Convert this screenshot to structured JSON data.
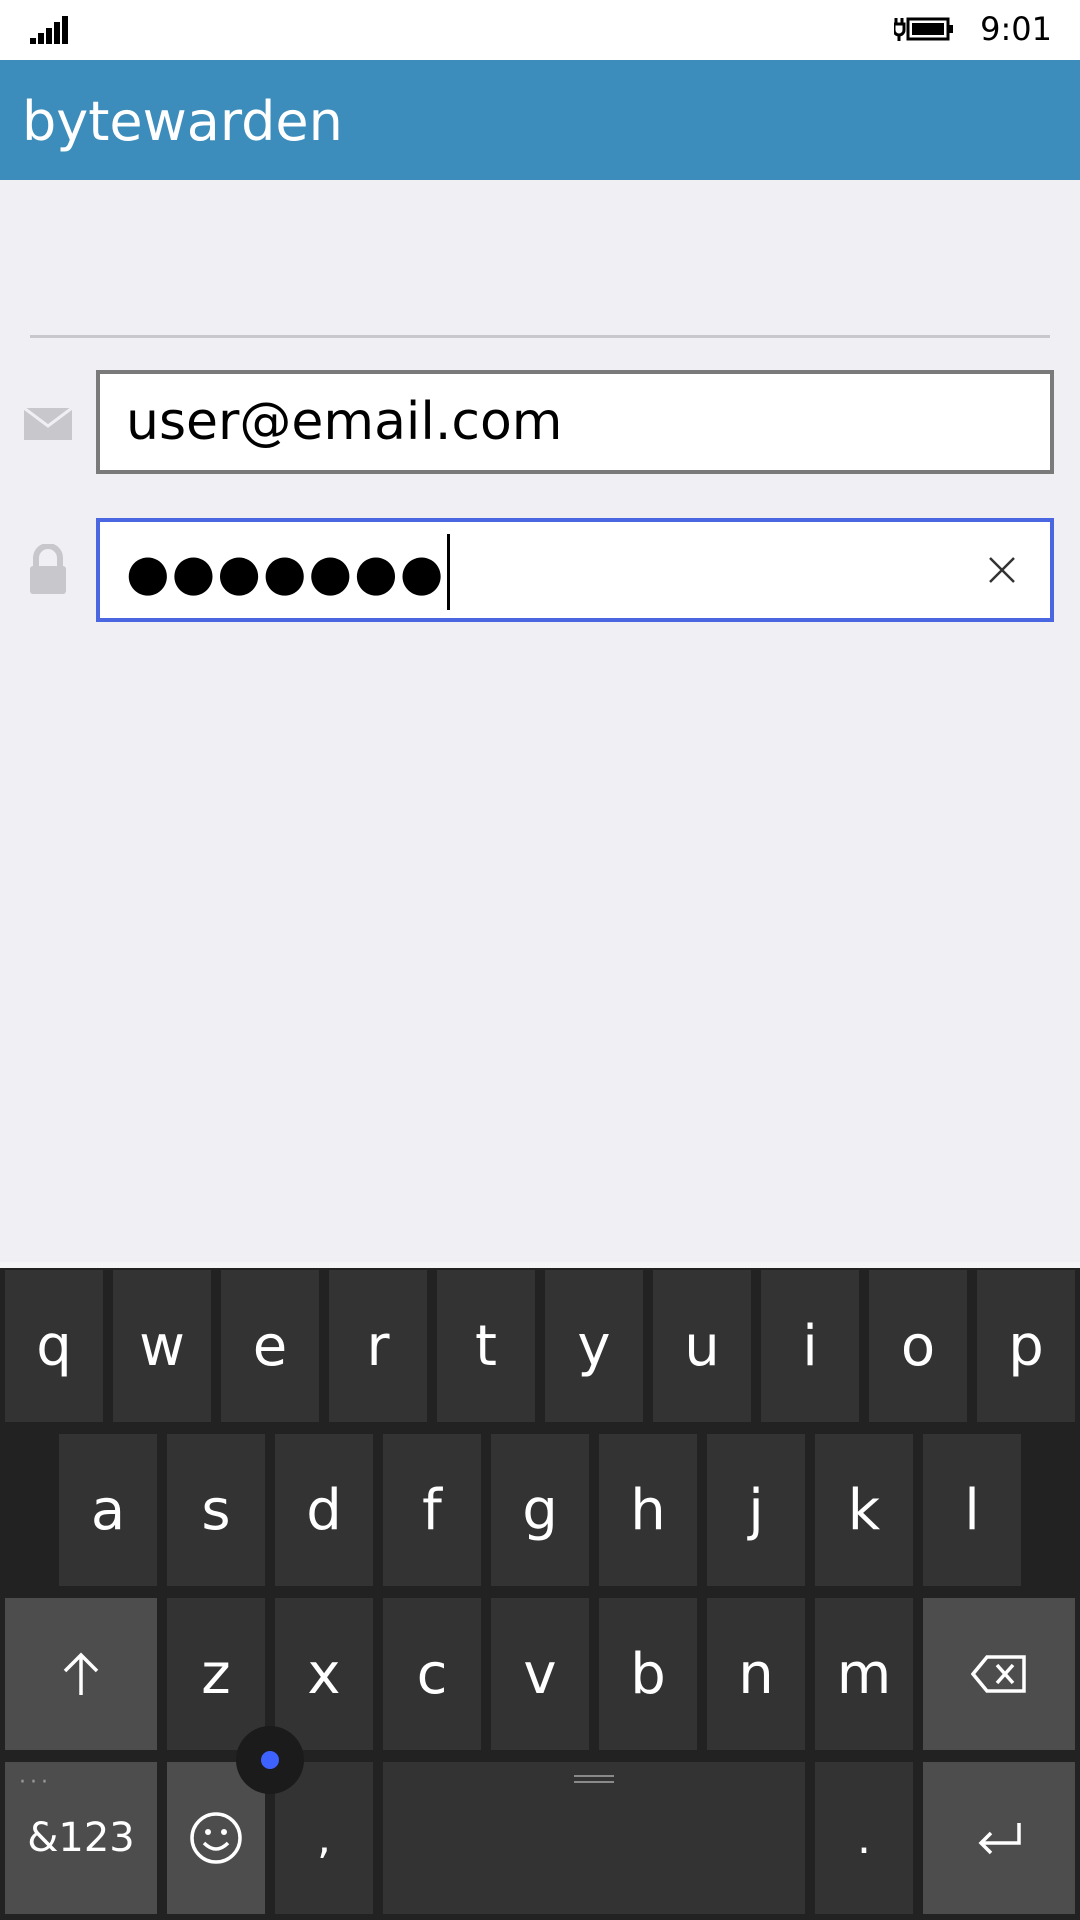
{
  "status_bar": {
    "time": "9:01",
    "signal_icon": "signal-bars-icon",
    "battery_icon": "battery-charging-icon"
  },
  "header": {
    "title": "bytewarden"
  },
  "form": {
    "email": {
      "icon": "envelope-icon",
      "value": "user@email.com"
    },
    "password": {
      "icon": "lock-icon",
      "masked_value": "●●●●●●●",
      "clear_icon": "close-icon"
    }
  },
  "keyboard": {
    "row1": [
      "q",
      "w",
      "e",
      "r",
      "t",
      "y",
      "u",
      "i",
      "o",
      "p"
    ],
    "row2": [
      "a",
      "s",
      "d",
      "f",
      "g",
      "h",
      "j",
      "k",
      "l"
    ],
    "row3": [
      "z",
      "x",
      "c",
      "v",
      "b",
      "n",
      "m"
    ],
    "bottom": {
      "symbols_label": "&123",
      "comma": ",",
      "period": "."
    },
    "icons": {
      "shift": "shift-arrow-icon",
      "backspace": "backspace-icon",
      "emoji": "emoji-icon",
      "enter": "enter-icon"
    },
    "accent": "#3d62ff"
  }
}
